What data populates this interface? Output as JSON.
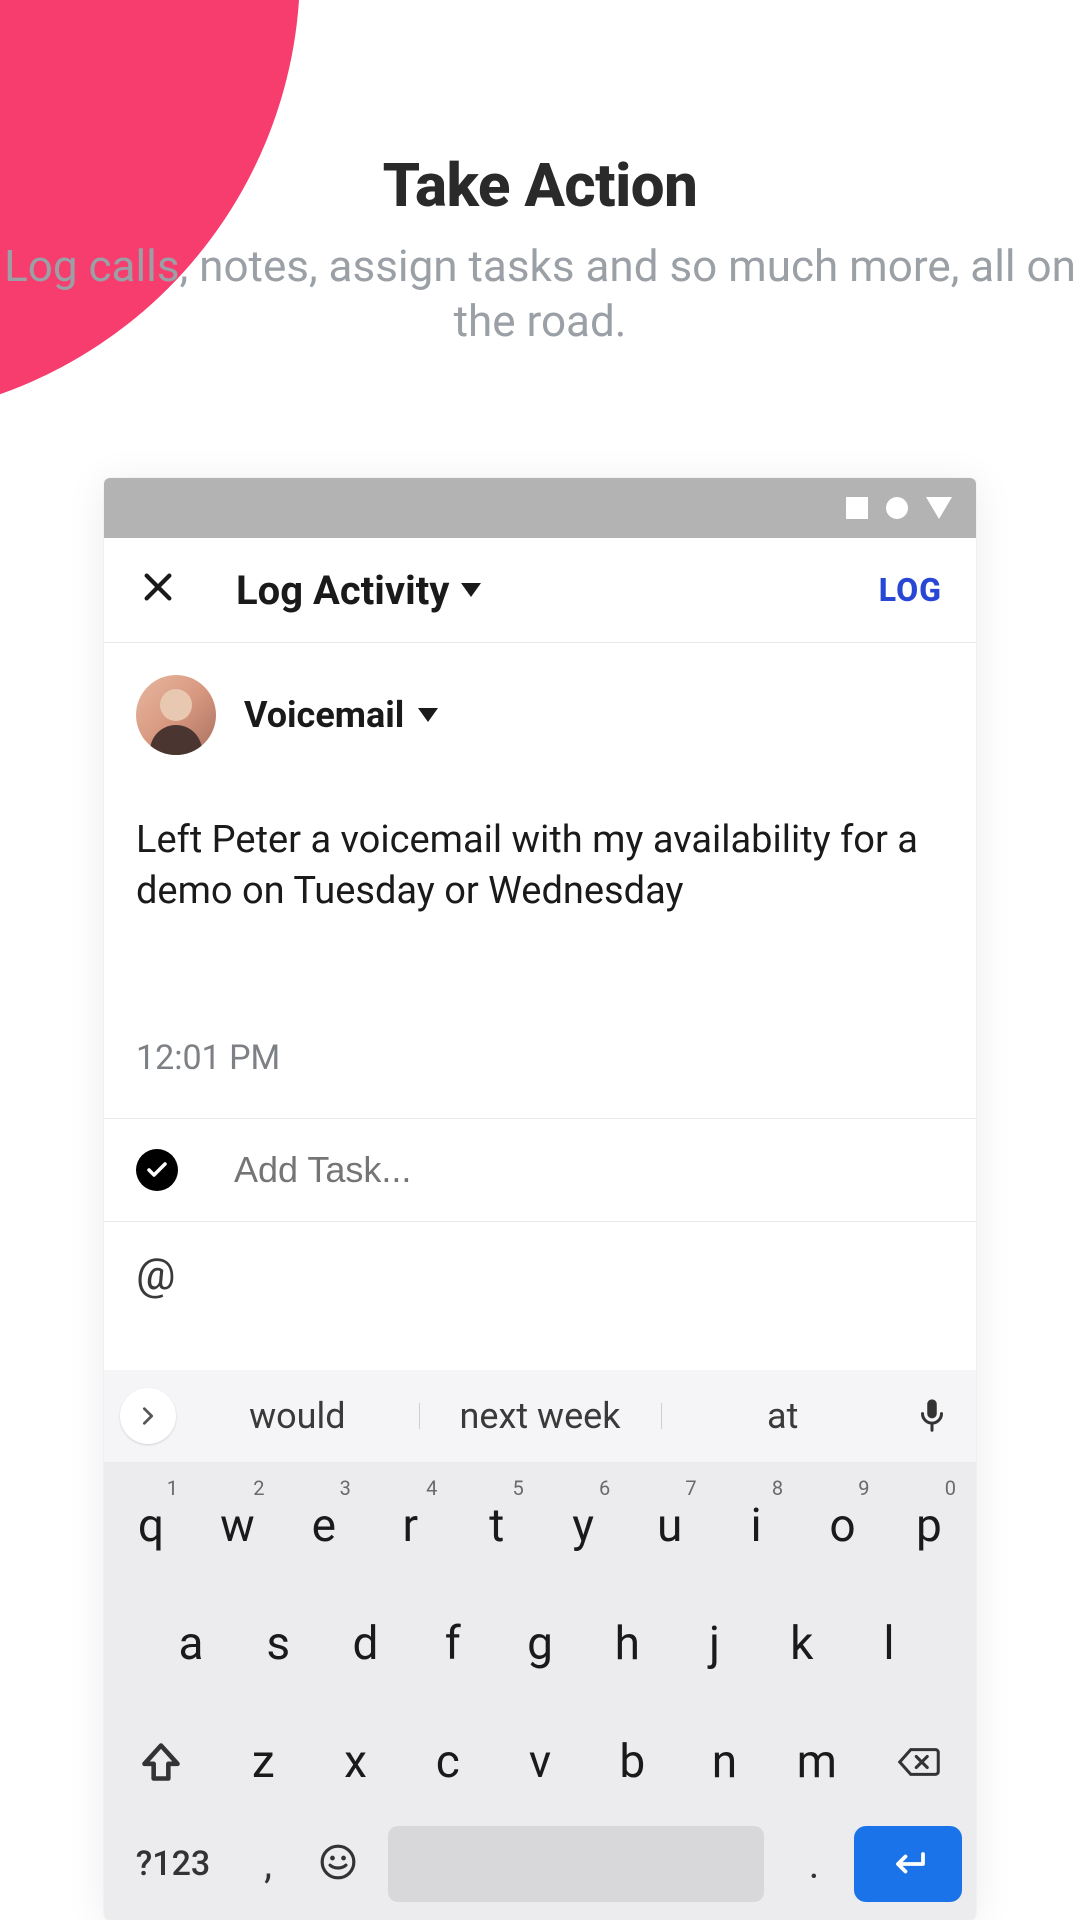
{
  "hero": {
    "title": "Take Action",
    "subtitle": "Log calls, notes, assign tasks and so much more, all on the road."
  },
  "header": {
    "screen_title": "Log Activity",
    "action": "LOG"
  },
  "entry": {
    "type_label": "Voicemail",
    "note": "Left Peter a voicemail with my availability for a demo on Tuesday or Wednesday",
    "time": "12:01 PM",
    "task_placeholder": "Add Task...",
    "mention_symbol": "@"
  },
  "keyboard": {
    "suggestions": [
      "would",
      "next week",
      "at"
    ],
    "row1": [
      {
        "c": "q",
        "n": "1"
      },
      {
        "c": "w",
        "n": "2"
      },
      {
        "c": "e",
        "n": "3"
      },
      {
        "c": "r",
        "n": "4"
      },
      {
        "c": "t",
        "n": "5"
      },
      {
        "c": "y",
        "n": "6"
      },
      {
        "c": "u",
        "n": "7"
      },
      {
        "c": "i",
        "n": "8"
      },
      {
        "c": "o",
        "n": "9"
      },
      {
        "c": "p",
        "n": "0"
      }
    ],
    "row2": [
      "a",
      "s",
      "d",
      "f",
      "g",
      "h",
      "j",
      "k",
      "l"
    ],
    "row3": [
      "z",
      "x",
      "c",
      "v",
      "b",
      "n",
      "m"
    ],
    "symbols_label": "?123",
    "comma": ",",
    "period": "."
  }
}
